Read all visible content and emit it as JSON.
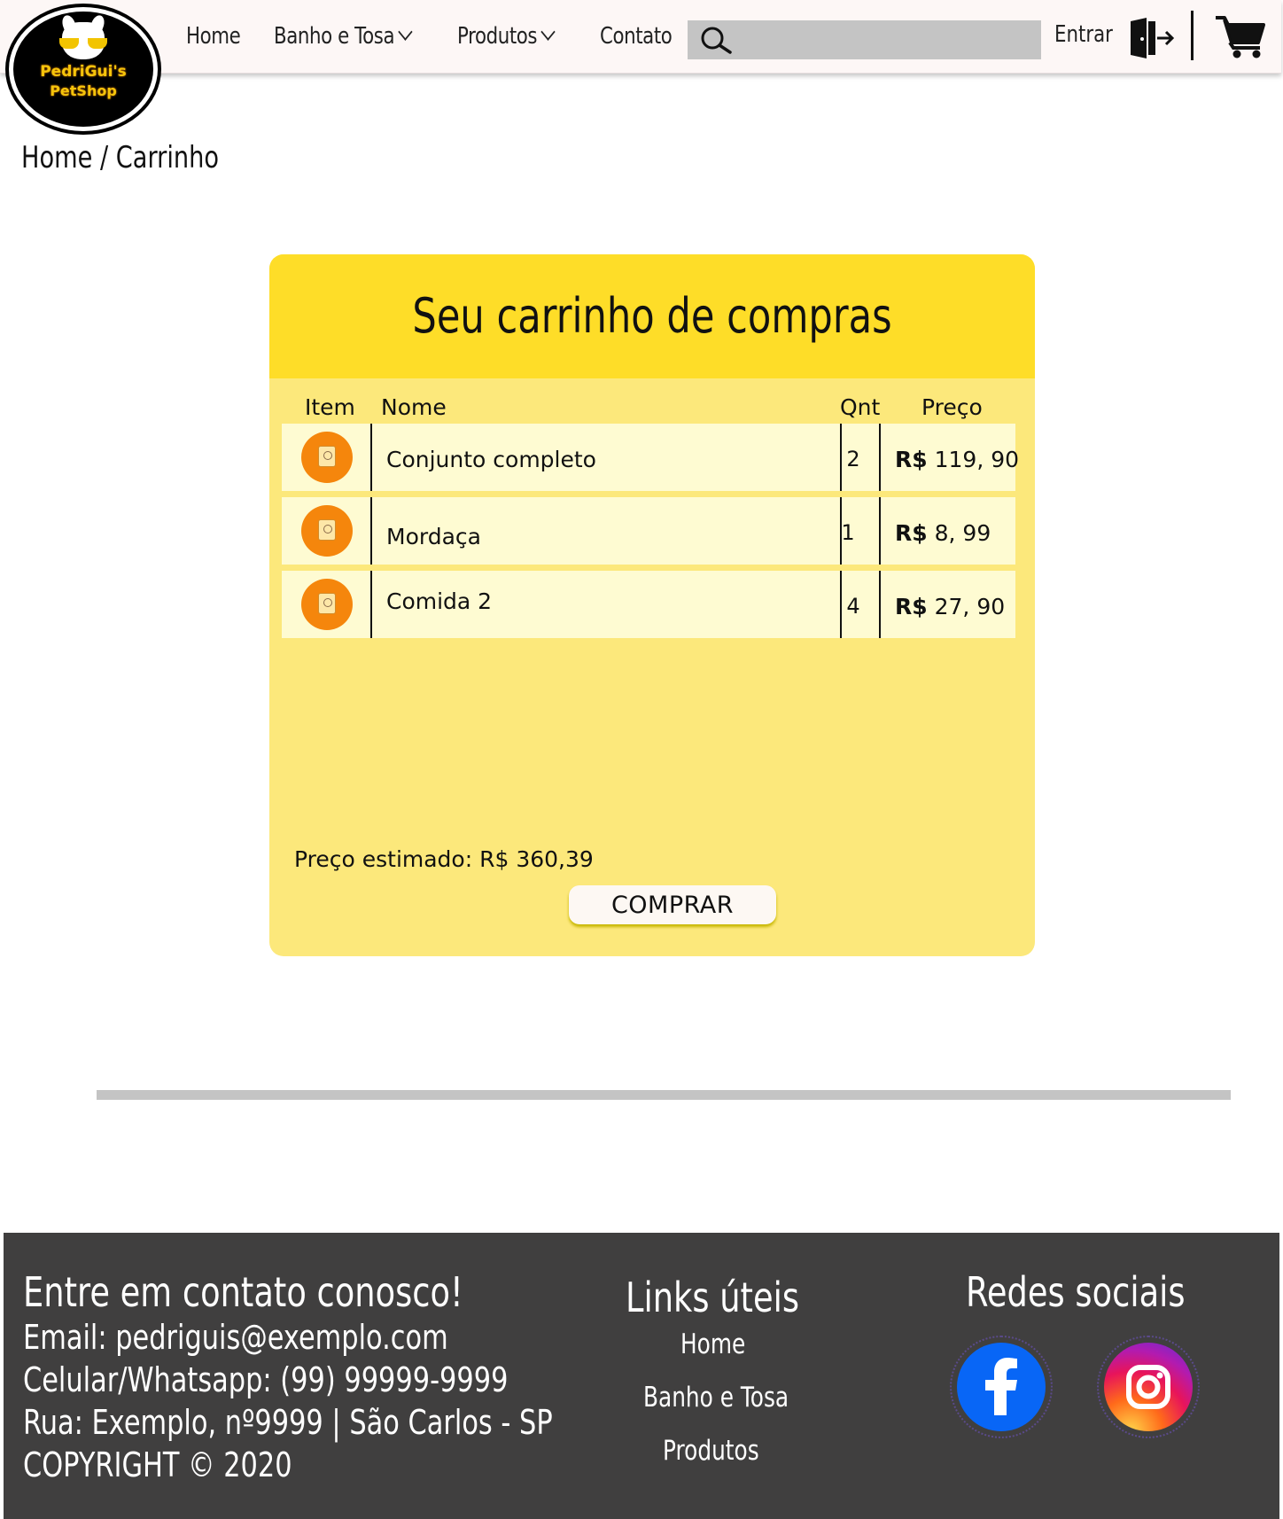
{
  "brand": {
    "logo_line1": "PedriGui's",
    "logo_line2": "PetShop"
  },
  "nav": {
    "home": "Home",
    "banho": "Banho e Tosa",
    "produtos": "Produtos",
    "contato": "Contato",
    "search_placeholder": "",
    "login": "Entrar"
  },
  "breadcrumb": "Home / Carrinho",
  "cart": {
    "title": "Seu carrinho de compras",
    "headers": {
      "item": "Item",
      "nome": "Nome",
      "qnt": "Qnt",
      "preco": "Preço"
    },
    "items": [
      {
        "name": "Conjunto completo",
        "qty": "2",
        "currency": "R$",
        "price": "119, 90"
      },
      {
        "name": "Mordaça",
        "qty": "1",
        "currency": "R$",
        "price": "8, 99"
      },
      {
        "name": "Comida 2",
        "qty": "4",
        "currency": "R$",
        "price": "27, 90"
      }
    ],
    "total_label": "Preço estimado:",
    "total_value": "R$ 360,39",
    "buy_button": "COMPRAR"
  },
  "footer": {
    "contact_title": "Entre em contato conosco!",
    "email": "Email: pedriguis@exemplo.com",
    "phone": "Celular/Whatsapp: (99) 99999-9999",
    "address": "Rua: Exemplo, nº9999 | São Carlos - SP",
    "copyright": "COPYRIGHT © 2020",
    "links_title": "Links úteis",
    "links": [
      "Home",
      "Banho e Tosa",
      "Produtos"
    ],
    "social_title": "Redes sociais",
    "social": [
      "facebook-icon",
      "instagram-icon"
    ]
  },
  "colors": {
    "header_bg": "#fdf7f6",
    "card_head": "#fedd28",
    "card_body": "#fce87b",
    "row_bg": "#fefbd2",
    "thumb": "#f5860c",
    "footer_bg": "#403f3f",
    "search_bg": "#c4c4c4"
  }
}
